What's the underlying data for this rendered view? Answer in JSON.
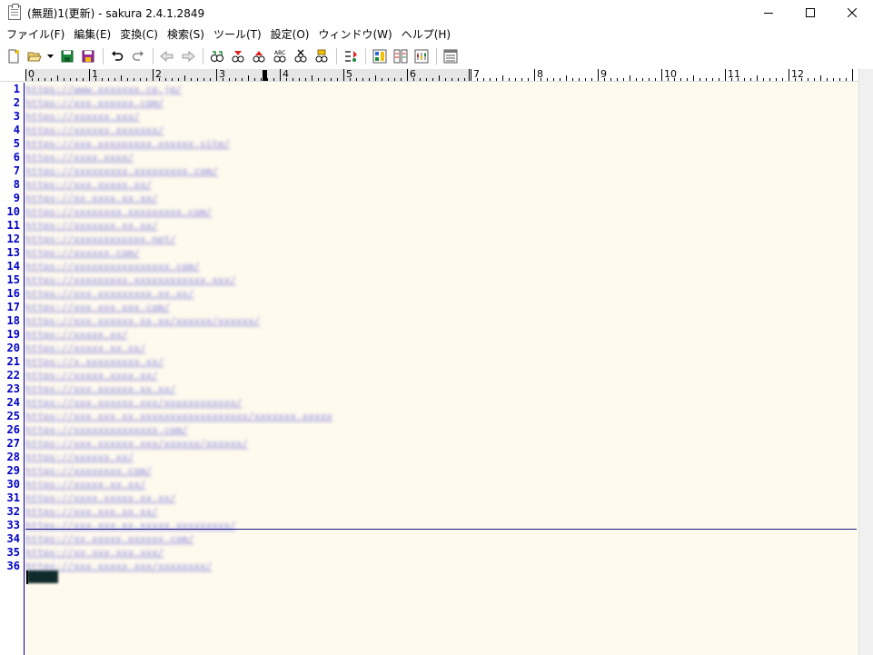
{
  "window": {
    "title": "(無題)1(更新) - sakura 2.4.1.2849",
    "icon": "notepad-icon"
  },
  "window_controls": {
    "minimize_icon": "minimize-icon",
    "maximize_icon": "maximize-icon",
    "close_icon": "close-icon"
  },
  "menu": {
    "items": [
      {
        "label": "ファイル(F)"
      },
      {
        "label": "編集(E)"
      },
      {
        "label": "変換(C)"
      },
      {
        "label": "検索(S)"
      },
      {
        "label": "ツール(T)"
      },
      {
        "label": "設定(O)"
      },
      {
        "label": "ウィンドウ(W)"
      },
      {
        "label": "ヘルプ(H)"
      }
    ]
  },
  "toolbar": {
    "buttons": [
      "new-file-icon",
      "open-folder-icon",
      "save-icon",
      "save-all-icon",
      "undo-icon",
      "redo-icon",
      "back-icon",
      "forward-icon",
      "search-icon",
      "search-prev-icon",
      "search-next-icon",
      "replace-icon",
      "cut-search-icon",
      "glasses-icon",
      "grep-icon",
      "outline-icon",
      "compare-icon",
      "settings-icon",
      "window-list-icon"
    ]
  },
  "ruler": {
    "numbers": [
      "0",
      "1",
      "2",
      "3",
      "4",
      "5",
      "6",
      "7",
      "8",
      "9",
      "10",
      "11",
      "12"
    ]
  },
  "editor": {
    "line_numbers": [
      "1",
      "2",
      "3",
      "4",
      "5",
      "6",
      "7",
      "8",
      "9",
      "10",
      "11",
      "12",
      "13",
      "14",
      "15",
      "16",
      "17",
      "18",
      "19",
      "20",
      "21",
      "22",
      "23",
      "24",
      "25",
      "26",
      "27",
      "28",
      "29",
      "30",
      "31",
      "32",
      "33",
      "34",
      "35",
      "36"
    ],
    "lines": [
      "https://www.xxxxxxx.co.jp/",
      "https://xxx.xxxxxx.com/",
      "https://xxxxxx.xxx/",
      "https://xxxxxx.xxxxxxx/",
      "https://xxx.xxxxxxxxx.xxxxxx.site/",
      "https://xxxx.xxxx/",
      "https://xxxxxxxxx.xxxxxxxxx.com/",
      "https://xxx.xxxxx.xx/",
      "https://xx.xxxx.xx.xx/",
      "https://xxxxxxxx.xxxxxxxxx.com/",
      "https://xxxxxxx.xx.xx/",
      "https://xxxxxxxxxxxx.net/",
      "https://xxxxxx.com/",
      "https://xxxxxxxxxxxxxxxx.com/",
      "https://xxxxxxxxx.xxxxxxxxxxxx.xxx/",
      "https://xxx.xxxxxxxxx.xx.xx/",
      "https://xxx.xxx.xxx.com/",
      "https://xxx.xxxxxx.xx.xx/xxxxxx/xxxxxx/",
      "https://xxxxx.xx/",
      "https://xxxxx.xx.xx/",
      "https://x.xxxxxxxxx.xx/",
      "https://xxxxx.xxxx.xx/",
      "https://xxx.xxxxxx.xx.xx/",
      "https://xxx.xxxxxx.xxx/xxxxxxxxxxxx/",
      "https://xxx.xxx.xx.xxxxxxxxxxxxxxxxxx/xxxxxxx.xxxxx",
      "https://xxxxxxxxxxxxxx.com/",
      "https://xxx.xxxxxx.xxx/xxxxxx/xxxxxx/",
      "https://xxxxxx.xx/",
      "https://xxxxxxxx.com/",
      "https://xxxxx.xx.xx/",
      "https://xxxx.xxxxx.xx.xx/",
      "https://xxx.xxx.xx.xx/",
      "https://xxx.xxx.xx.xxxxx.xxxxxxxxx/",
      "https://xx.xxxxx.xxxxxx.com/",
      "https://xx.xxx.xxx.xxx/",
      "https://xxx.xxxxx.xxx/xxxxxxxx/"
    ],
    "eof_label": "[EOF]"
  }
}
